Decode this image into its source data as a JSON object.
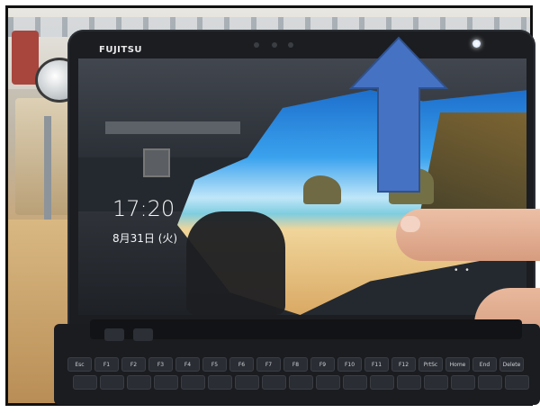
{
  "photo": {
    "laptop": {
      "brand": "FUJITSU"
    },
    "lock_screen": {
      "time": "17:20",
      "date": "8月31日 (火)"
    },
    "overlay": {
      "arrow_icon": "up-arrow-icon",
      "arrow_color": "#4672c4"
    },
    "keyboard": {
      "keys": [
        "Esc",
        "F1",
        "F2",
        "F3",
        "F4",
        "F5",
        "F6",
        "F7",
        "F8",
        "F9",
        "F10",
        "F11",
        "F12",
        "PrtSc",
        "Home",
        "End",
        "Delete"
      ]
    }
  }
}
